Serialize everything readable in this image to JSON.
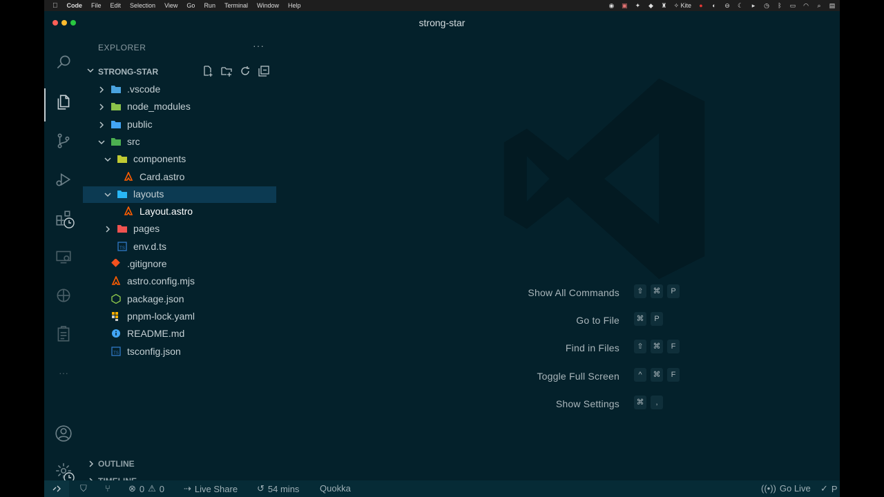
{
  "menubar": {
    "app": "Code",
    "items": [
      "File",
      "Edit",
      "Selection",
      "View",
      "Go",
      "Run",
      "Terminal",
      "Window",
      "Help"
    ],
    "tray_kite": "Kite"
  },
  "window": {
    "title": "strong-star"
  },
  "sidebar": {
    "title": "EXPLORER",
    "more": "···",
    "project": "STRONG-STAR",
    "tree": [
      {
        "label": ".vscode",
        "indent": 0,
        "chev": "right",
        "icon": "folder-vscode-icon",
        "color": "#4aa3df"
      },
      {
        "label": "node_modules",
        "indent": 0,
        "chev": "right",
        "icon": "folder-node-icon",
        "color": "#8bc34a"
      },
      {
        "label": "public",
        "indent": 0,
        "chev": "right",
        "icon": "folder-public-icon",
        "color": "#42a5f5"
      },
      {
        "label": "src",
        "indent": 0,
        "chev": "down",
        "icon": "folder-src-icon",
        "color": "#4caf50"
      },
      {
        "label": "components",
        "indent": 1,
        "chev": "down",
        "icon": "folder-components-icon",
        "color": "#c0ca33"
      },
      {
        "label": "Card.astro",
        "indent": 2,
        "chev": "",
        "icon": "astro-file-icon",
        "color": "#ff5d01"
      },
      {
        "label": "layouts",
        "indent": 1,
        "chev": "down",
        "icon": "folder-layouts-icon",
        "color": "#29b6f6"
      },
      {
        "label": "Layout.astro",
        "indent": 2,
        "chev": "",
        "icon": "astro-file-icon",
        "color": "#ff5d01"
      },
      {
        "label": "pages",
        "indent": 1,
        "chev": "right",
        "icon": "folder-pages-icon",
        "color": "#ef5350"
      },
      {
        "label": "env.d.ts",
        "indent": 1,
        "chev": "",
        "icon": "typescript-def-icon",
        "color": "#3178c6"
      },
      {
        "label": ".gitignore",
        "indent": 0,
        "chev": "",
        "icon": "git-icon",
        "color": "#f4511e"
      },
      {
        "label": "astro.config.mjs",
        "indent": 0,
        "chev": "",
        "icon": "astro-file-icon",
        "color": "#ff5d01"
      },
      {
        "label": "package.json",
        "indent": 0,
        "chev": "",
        "icon": "nodejs-icon",
        "color": "#8bc34a"
      },
      {
        "label": "pnpm-lock.yaml",
        "indent": 0,
        "chev": "",
        "icon": "pnpm-icon",
        "color": "#f9ad00"
      },
      {
        "label": "README.md",
        "indent": 0,
        "chev": "",
        "icon": "info-icon",
        "color": "#42a5f5"
      },
      {
        "label": "tsconfig.json",
        "indent": 0,
        "chev": "",
        "icon": "tsconfig-icon",
        "color": "#3178c6"
      }
    ],
    "outline": "OUTLINE",
    "timeline": "TIMELINE"
  },
  "editor": {
    "commands": [
      {
        "label": "Show All Commands",
        "keys": [
          "⇧",
          "⌘",
          "P"
        ]
      },
      {
        "label": "Go to File",
        "keys": [
          "⌘",
          "P"
        ]
      },
      {
        "label": "Find in Files",
        "keys": [
          "⇧",
          "⌘",
          "F"
        ]
      },
      {
        "label": "Toggle Full Screen",
        "keys": [
          "^",
          "⌘",
          "F"
        ]
      },
      {
        "label": "Show Settings",
        "keys": [
          "⌘",
          ","
        ]
      }
    ]
  },
  "statusbar": {
    "errors": "0",
    "warnings": "0",
    "live_share": "Live Share",
    "time": "54 mins",
    "quokka": "Quokka",
    "go_live": "Go Live",
    "trailing": "P"
  }
}
